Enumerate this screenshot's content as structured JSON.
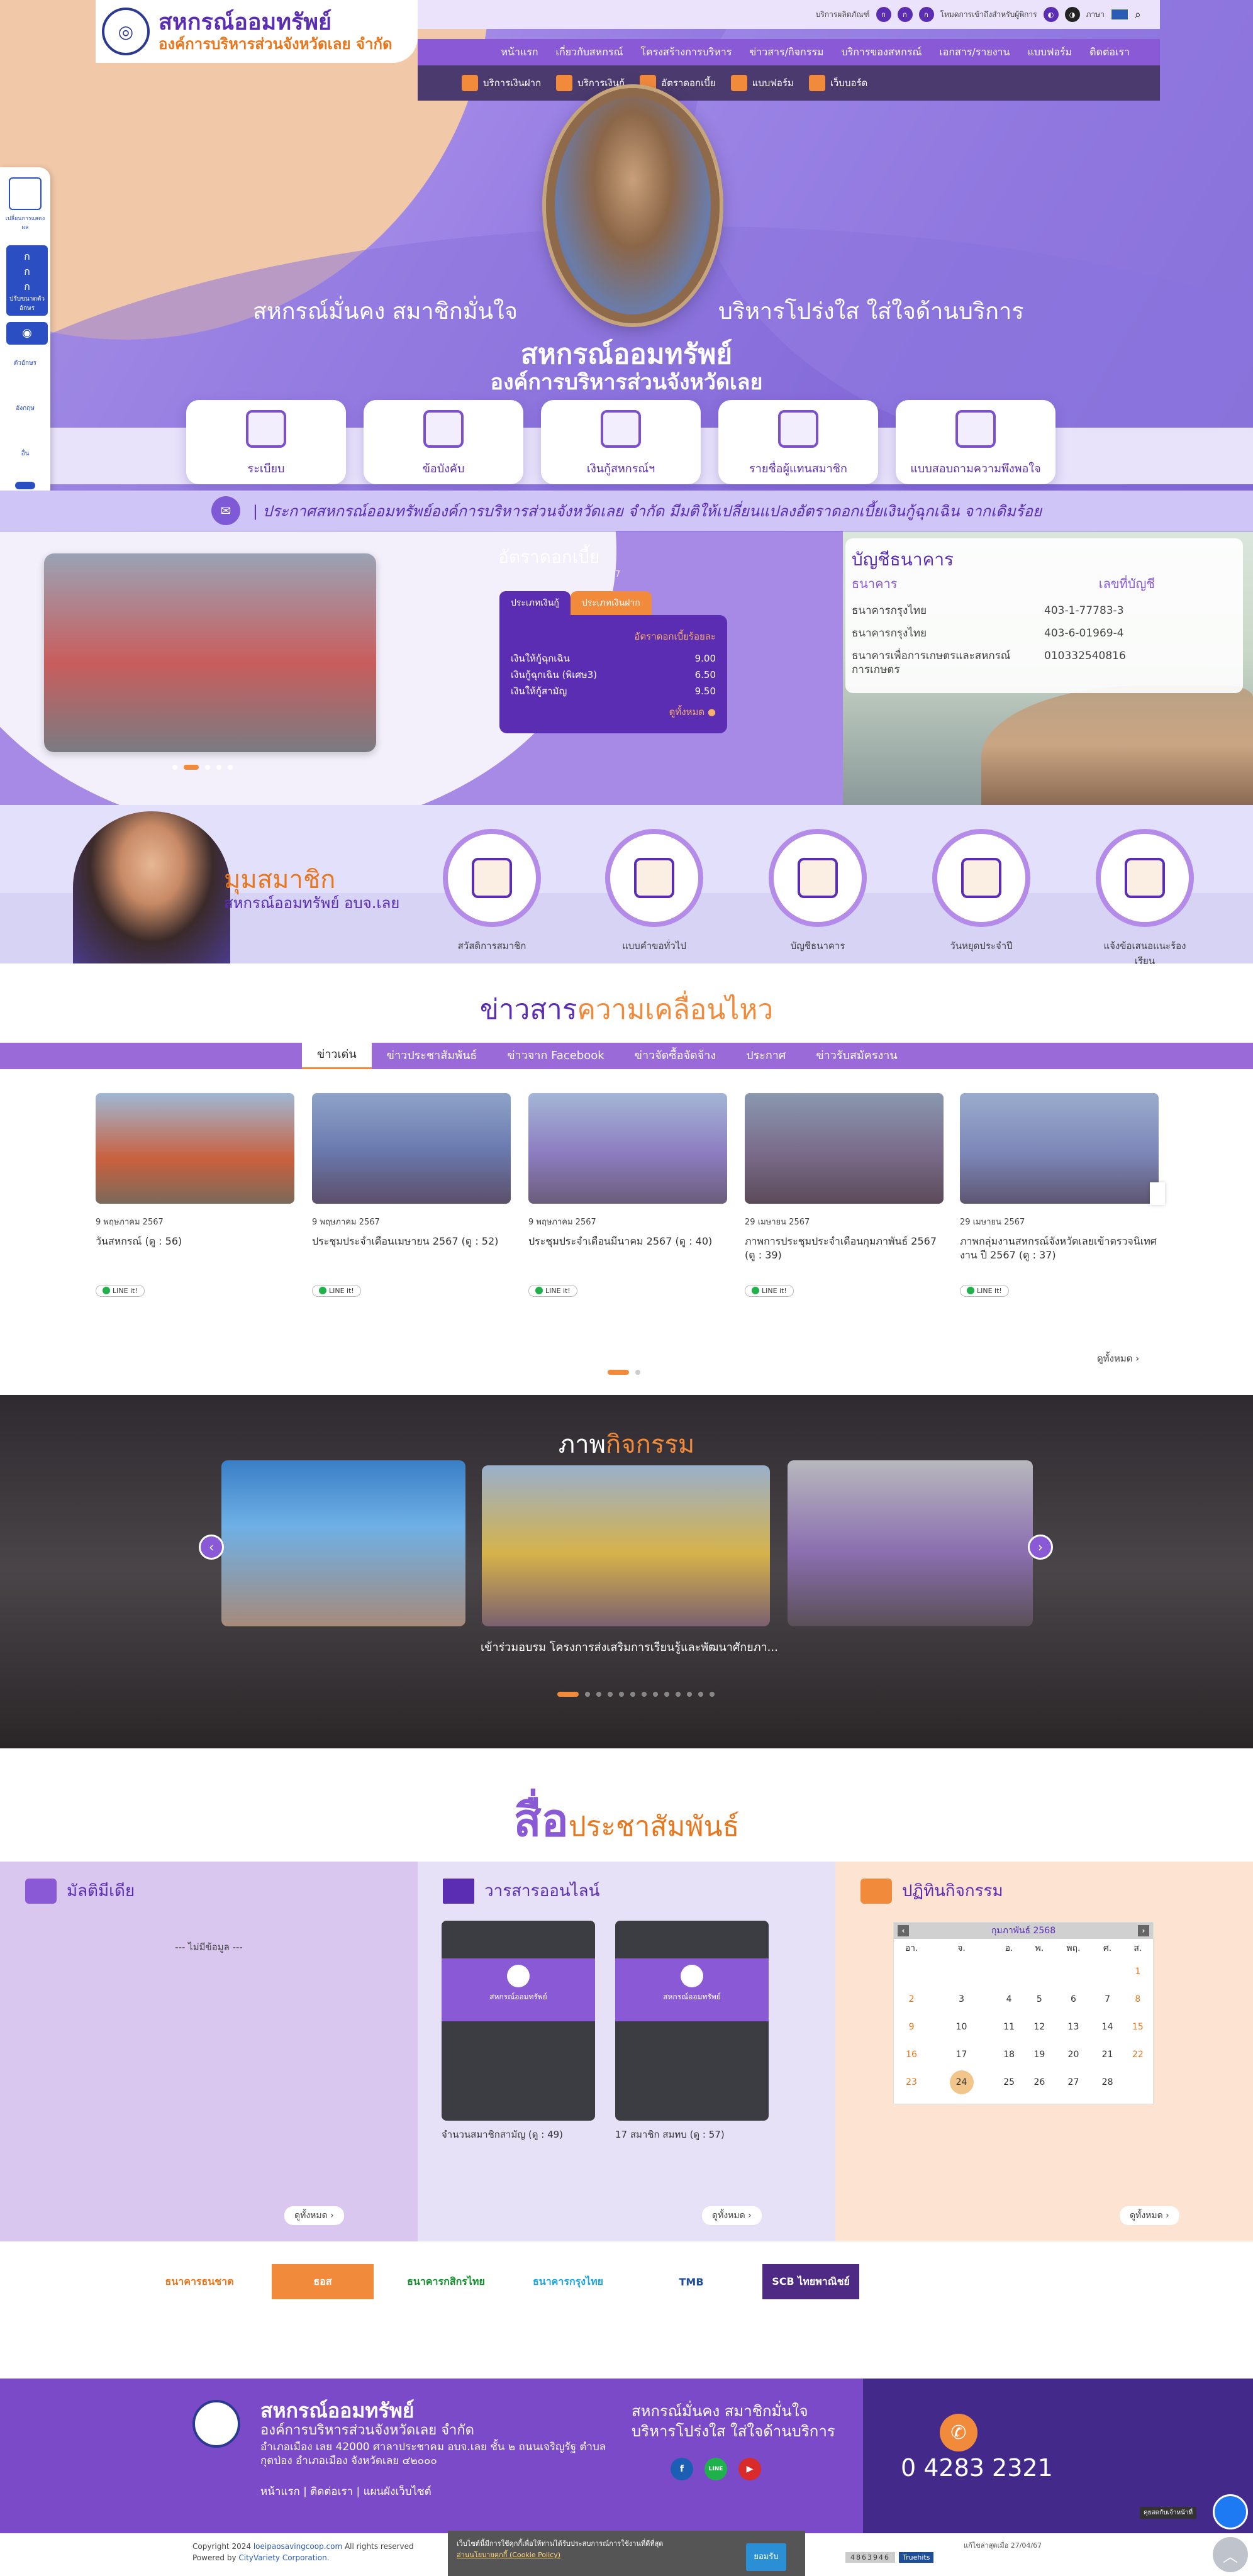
{
  "brand": {
    "name": "สหกรณ์ออมทรัพย์",
    "sub": "องค์การบริหารส่วนจังหวัดเลย จำกัด"
  },
  "topbar": {
    "items": [
      "บริการผลิตภัณฑ์",
      "โหมดการเข้าถึงสำหรับผู้พิการ",
      "ภาษา"
    ],
    "font_sizes": [
      "ก",
      "ก",
      "ก"
    ]
  },
  "nav": [
    "หน้าแรก",
    "เกี่ยวกับสหกรณ์",
    "โครงสร้างการบริหาร",
    "ข่าวสาร/กิจกรรม",
    "บริการของสหกรณ์",
    "เอกสาร/รายงาน",
    "แบบฟอร์ม",
    "ติดต่อเรา"
  ],
  "subnav": [
    "บริการเงินฝาก",
    "บริการเงินกู้",
    "อัตราดอกเบี้ย",
    "แบบฟอร์ม",
    "เว็บบอร์ด"
  ],
  "hero": {
    "slogan_left": "สหกรณ์มั่นคง สมาชิกมั่นใจ",
    "slogan_right": "บริหารโปร่งใส ใส่ใจด้านบริการ",
    "title": "สหกรณ์ออมทรัพย์",
    "subtitle": "องค์การบริหารส่วนจังหวัดเลย"
  },
  "services": [
    "ระเบียบ",
    "ข้อบังคับ",
    "เงินกู้สหกรณ์ฯ",
    "รายชื่อผู้แทนสมาชิก",
    "แบบสอบถามความพึงพอใจ"
  ],
  "left_side": {
    "a": "เปลี่ยนการแสดงผล",
    "b": "ปรับขนาดตัวอักษร",
    "c": "ตัวอักษร",
    "d": "อังกฤษ",
    "e": "อื่น"
  },
  "ticker": "| ประกาศสหกรณ์ออมทรัพย์องค์การบริหารส่วนจังหวัดเลย จำกัด มีมติให้เปลี่ยนแปลงอัตราดอกเบี้ยเงินกู้ฉุกเฉิน จากเดิมร้อย",
  "rates": {
    "title": "อัตราดอกเบี้ย",
    "date": "อัพเดทล่าสุด 12/06/2567, 14:17",
    "tabs": [
      "ประเภทเงินกู้",
      "ประเภทเงินฝาก"
    ],
    "header": "อัตราดอกเบี้ยร้อยละ",
    "rows": [
      {
        "name": "เงินให้กู้ฉุกเฉิน",
        "value": "9.00"
      },
      {
        "name": "เงินกู้ฉุกเฉิน (พิเศษ3)",
        "value": "6.50"
      },
      {
        "name": "เงินให้กู้สามัญ",
        "value": "9.50"
      }
    ],
    "more": "ดูทั้งหมด ●"
  },
  "accounts": {
    "title": "บัญชีธนาคาร",
    "col_bank": "ธนาคาร",
    "col_no": "เลขที่บัญชี",
    "rows": [
      {
        "bank": "ธนาคารกรุงไทย",
        "no": "403-1-77783-3"
      },
      {
        "bank": "ธนาคารกรุงไทย",
        "no": "403-6-01969-4"
      },
      {
        "bank": "ธนาคารเพื่อการเกษตรและสหกรณ์การเกษตร",
        "no": "010332540816"
      }
    ]
  },
  "member": {
    "title": "มุมสมาชิก",
    "subtitle": "สหกรณ์ออมทรัพย์ อบจ.เลย",
    "items": [
      "สวัสดิการสมาชิก",
      "แบบคำขอทั่วไป",
      "บัญชีธนาคาร",
      "วันหยุดประจำปี",
      "แจ้งข้อเสนอแนะร้องเรียน"
    ]
  },
  "news": {
    "title_a": "ข่าวสาร",
    "title_b": "ความเคลื่อนไหว",
    "tabs": [
      "ข่าวเด่น",
      "ข่าวประชาสัมพันธ์",
      "ข่าวจาก Facebook",
      "ข่าวจัดซื้อจัดจ้าง",
      "ประกาศ",
      "ข่าวรับสมัครงาน"
    ],
    "items": [
      {
        "date": "9 พฤษภาคม 2567",
        "title": "วันสหกรณ์ (ดู : 56)"
      },
      {
        "date": "9 พฤษภาคม 2567",
        "title": "ประชุมประจำเดือนเมษายน 2567 (ดู : 52)"
      },
      {
        "date": "9 พฤษภาคม 2567",
        "title": "ประชุมประจำเดือนมีนาคม 2567 (ดู : 40)"
      },
      {
        "date": "29 เมษายน 2567",
        "title": "ภาพการประชุมประจำเดือนกุมภาพันธ์ 2567 (ดู : 39)"
      },
      {
        "date": "29 เมษายน 2567",
        "title": "ภาพกลุ่มงานสหกรณ์จังหวัดเลยเข้าตรวจนิเทศงาน ปี 2567 (ดู : 37)"
      }
    ],
    "line_label": "LINE it!",
    "more": "ดูทั้งหมด ›"
  },
  "activity": {
    "title_a": "ภาพ",
    "title_b": "กิจกรรม",
    "caption": "เข้าร่วมอบรม โครงการส่งเสริมการเรียนรู้และพัฒนาศักยภา..."
  },
  "media": {
    "title_a": "สื่อ",
    "title_b": "ประชาสัมพันธ์",
    "multimedia": "มัลติมีเดีย",
    "no_data": "--- ไม่มีข้อมูล ---",
    "journal": "วารสารออนไลน์",
    "journals": [
      {
        "caption": "จำนวนสมาชิกสามัญ (ดู : 49)"
      },
      {
        "caption": "17 สมาชิก สมทบ (ดู : 57)"
      }
    ],
    "calendar": "ปฏิทินกิจกรรม",
    "more": "ดูทั้งหมด ›"
  },
  "calendar": {
    "month": "กุมภาพันธ์ 2568",
    "days": [
      "อา.",
      "จ.",
      "อ.",
      "พ.",
      "พฤ.",
      "ศ.",
      "ส."
    ],
    "weeks": [
      [
        "",
        "",
        "",
        "",
        "",
        "",
        "1"
      ],
      [
        "2",
        "3",
        "4",
        "5",
        "6",
        "7",
        "8"
      ],
      [
        "9",
        "10",
        "11",
        "12",
        "13",
        "14",
        "15"
      ],
      [
        "16",
        "17",
        "18",
        "19",
        "20",
        "21",
        "22"
      ],
      [
        "23",
        "24",
        "25",
        "26",
        "27",
        "28",
        ""
      ]
    ],
    "today": "24"
  },
  "banks": [
    {
      "name": "ธนาคารธนชาต",
      "color": "#e8761c"
    },
    {
      "name": "ธอส",
      "color": "#e8761c"
    },
    {
      "name": "ธนาคารกสิกรไทย",
      "color": "#138f2d"
    },
    {
      "name": "ธนาคารกรุงไทย",
      "color": "#1ba5e1"
    },
    {
      "name": "TMB",
      "color": "#1e4e9a"
    },
    {
      "name": "SCB ไทยพาณิชย์",
      "color": "#4e2a84"
    }
  ],
  "footer": {
    "title": "สหกรณ์ออมทรัพย์",
    "sub": "องค์การบริหารส่วนจังหวัดเลย จำกัด",
    "address": "อำเภอเมือง เลย 42000 ศาลาประชาคม อบจ.เลย ชั้น ๒ ถนนเจริญรัฐ ตำบลกุดป่อง อำเภอเมือง จังหวัดเลย ๔๒๐๐๐",
    "links": "หน้าแรก | ติดต่อเรา | แผนผังเว็บไซต์",
    "slogan1": "สหกรณ์มั่นคง สมาชิกมั่นใจ",
    "slogan2": "บริหารโปร่งใส ใส่ใจด้านบริการ",
    "phone": "0 4283 2321",
    "copyright": "Copyright 2024",
    "domain": "loeipaosavingcoop.com",
    "rights": "All rights reserved",
    "powered": "Powered by",
    "vendor": "CityVariety Corporation.",
    "cookie": "เว็บไซต์นี้มีการใช้คุกกี้เพื่อให้ท่านได้รับประสบการณ์การใช้งานที่ดีที่สุด",
    "cookie_link": "อ่านนโยบายคุกกี้ (Cookie Policy)",
    "accept": "ยอมรับ",
    "updated": "แก้ไขล่าสุดเมื่อ 27/04/67",
    "counter": "4863946",
    "truehits": "Truehits",
    "chat_label": "คุยสดกับเจ้าหน้าที่"
  },
  "colors": {
    "primary": "#5b2db3",
    "accent": "#f28a3c",
    "nav": "#8a5ad6"
  }
}
